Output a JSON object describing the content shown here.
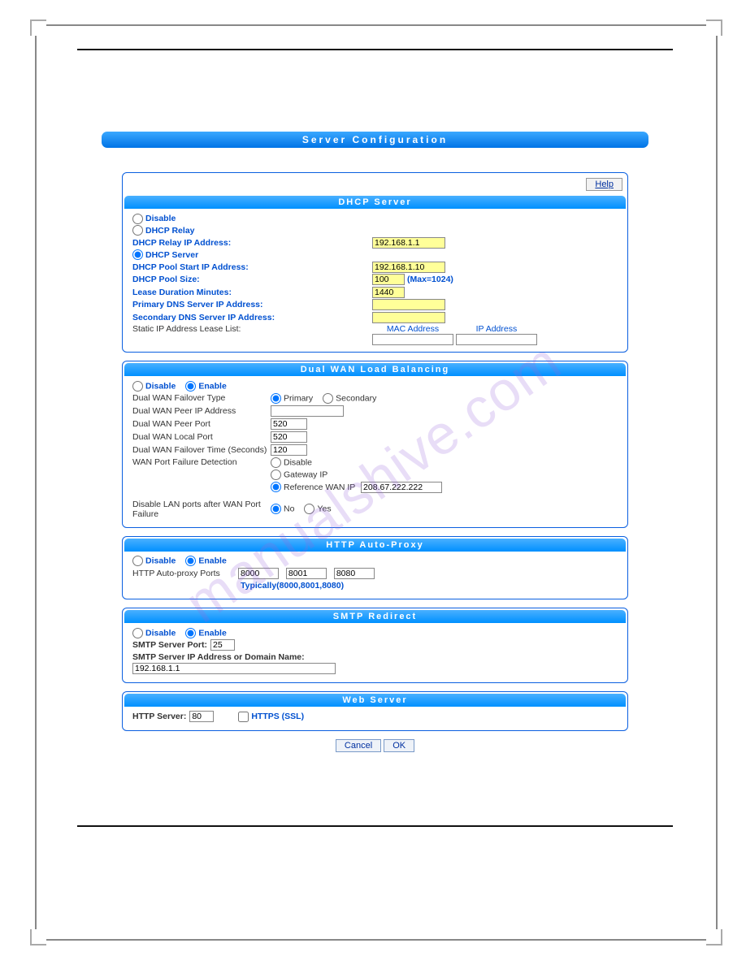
{
  "watermark": "manualshive.com",
  "page_title": "Server Configuration",
  "help_label": "Help",
  "dhcp": {
    "section_title": "DHCP Server",
    "disable_label": "Disable",
    "relay_label": "DHCP Relay",
    "relay_ip_label": "DHCP Relay IP Address:",
    "relay_ip_value": "192.168.1.1",
    "server_label": "DHCP Server",
    "pool_start_label": "DHCP Pool Start IP Address:",
    "pool_start_value": "192.168.1.10",
    "pool_size_label": "DHCP Pool Size:",
    "pool_size_value": "100",
    "pool_size_hint": "(Max=1024)",
    "lease_label": "Lease Duration Minutes:",
    "lease_value": "1440",
    "primary_dns_label": "Primary DNS Server IP Address:",
    "primary_dns_value": "",
    "secondary_dns_label": "Secondary DNS Server IP Address:",
    "secondary_dns_value": "",
    "static_list_label": "Static IP Address Lease List:",
    "mac_col": "MAC Address",
    "ip_col": "IP Address"
  },
  "dual": {
    "section_title": "Dual WAN Load Balancing",
    "disable": "Disable",
    "enable": "Enable",
    "failover_type_label": "Dual WAN Failover Type",
    "primary": "Primary",
    "secondary": "Secondary",
    "peer_ip_label": "Dual WAN Peer IP Address",
    "peer_ip_value": "",
    "peer_port_label": "Dual WAN Peer Port",
    "peer_port_value": "520",
    "local_port_label": "Dual WAN Local Port",
    "local_port_value": "520",
    "failover_time_label": "Dual WAN Failover Time (Seconds)",
    "failover_time_value": "120",
    "wan_failure_label": "WAN Port Failure Detection",
    "wan_failure_disable": "Disable",
    "wan_failure_gateway": "Gateway IP",
    "wan_failure_ref": "Reference WAN IP",
    "wan_failure_ref_value": "208.67.222.222",
    "disable_lan_label": "Disable LAN ports after WAN Port Failure",
    "no": "No",
    "yes": "Yes"
  },
  "proxy": {
    "section_title": "HTTP Auto-Proxy",
    "disable": "Disable",
    "enable": "Enable",
    "ports_label": "HTTP Auto-proxy Ports",
    "p1": "8000",
    "p2": "8001",
    "p3": "8080",
    "hint": "Typically(8000,8001,8080)"
  },
  "smtp": {
    "section_title": "SMTP Redirect",
    "disable": "Disable",
    "enable": "Enable",
    "port_label": "SMTP Server Port:",
    "port_value": "25",
    "addr_label": "SMTP Server IP Address or Domain Name:",
    "addr_value": "192.168.1.1"
  },
  "web": {
    "section_title": "Web Server",
    "http_label": "HTTP Server:",
    "http_value": "80",
    "https_label": "HTTPS  (SSL)"
  },
  "buttons": {
    "cancel": "Cancel",
    "ok": "OK"
  }
}
